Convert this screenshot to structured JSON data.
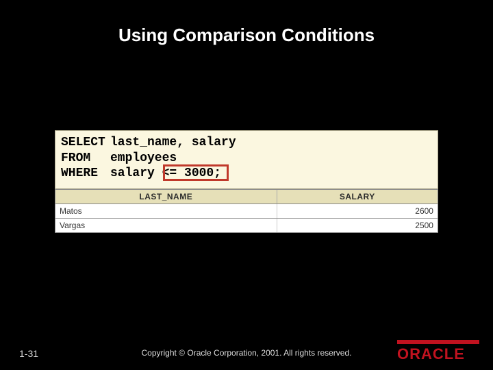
{
  "title": "Using Comparison Conditions",
  "sql": {
    "kw1": "SELECT",
    "expr1": "last_name, salary",
    "kw2": "FROM",
    "expr2": "employees",
    "kw3": "WHERE",
    "expr3_pre": "salary ",
    "expr3_op": "<= 3000",
    "expr3_post": ";"
  },
  "result": {
    "headers": {
      "c1": "LAST_NAME",
      "c2": "SALARY"
    },
    "rows": [
      {
        "c1": "Matos",
        "c2": "2600"
      },
      {
        "c1": "Vargas",
        "c2": "2500"
      }
    ]
  },
  "footer": {
    "page": "1-31",
    "copyright": "Copyright © Oracle Corporation, 2001. All rights reserved.",
    "logo": "ORACLE"
  },
  "chart_data": {
    "type": "table",
    "title": "Using Comparison Conditions",
    "query": "SELECT last_name, salary FROM employees WHERE salary <= 3000;",
    "columns": [
      "LAST_NAME",
      "SALARY"
    ],
    "rows": [
      [
        "Matos",
        2600
      ],
      [
        "Vargas",
        2500
      ]
    ]
  }
}
